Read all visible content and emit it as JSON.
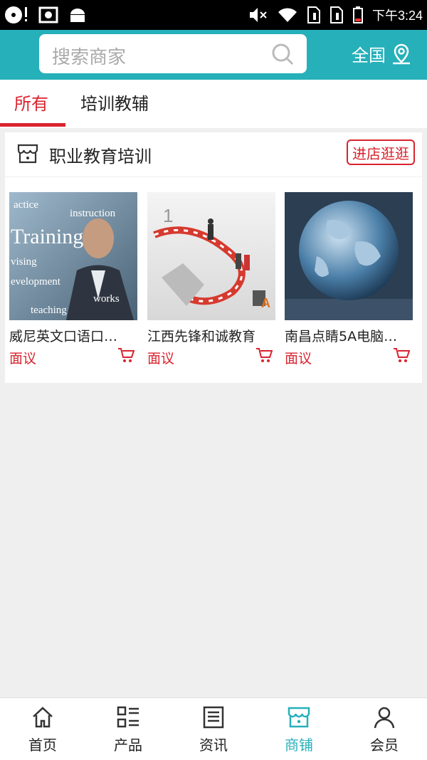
{
  "status_bar": {
    "time": "下午3:24"
  },
  "header": {
    "search_placeholder": "搜索商家",
    "region_label": "全国",
    "accent_color": "#26b0ba"
  },
  "tabs": [
    {
      "label": "所有",
      "active": true
    },
    {
      "label": "培训教辅",
      "active": false
    }
  ],
  "shop": {
    "name": "职业教育培训",
    "enter_label": "进店逛逛",
    "products": [
      {
        "name": "威尼英文口语口…",
        "price": "面议"
      },
      {
        "name": "江西先锋和诚教育",
        "price": "面议"
      },
      {
        "name": "南昌点睛5A电脑…",
        "price": "面议"
      }
    ]
  },
  "bottom_nav": [
    {
      "label": "首页",
      "icon": "home-icon"
    },
    {
      "label": "产品",
      "icon": "grid-list-icon"
    },
    {
      "label": "资讯",
      "icon": "news-icon"
    },
    {
      "label": "商铺",
      "icon": "shop-icon",
      "active": true
    },
    {
      "label": "会员",
      "icon": "user-icon"
    }
  ]
}
